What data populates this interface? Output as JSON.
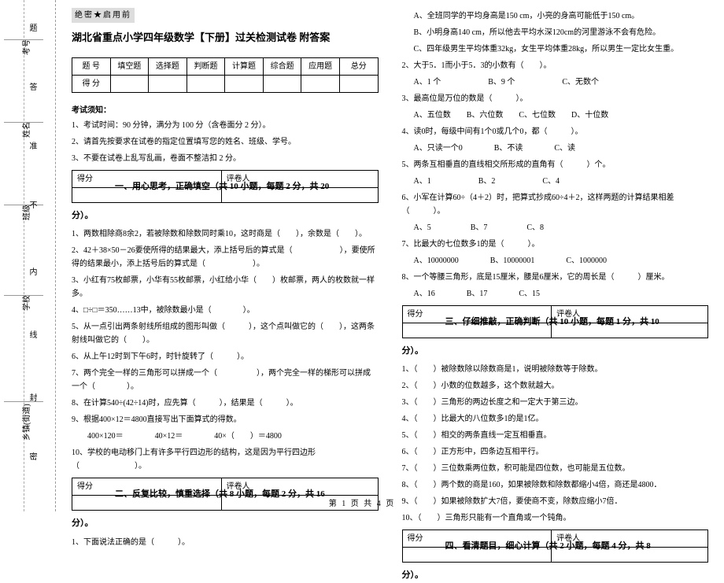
{
  "margin": {
    "fields": [
      "考号",
      "姓名",
      "班级",
      "学校",
      "乡镇(街道)"
    ],
    "seal_chars": [
      "题",
      "答",
      "准",
      "不",
      "内",
      "线",
      "封",
      "密"
    ]
  },
  "secret": "绝密★启用前",
  "title": "湖北省重点小学四年级数学【下册】过关检测试卷 附答案",
  "score_table": {
    "row1": [
      "题  号",
      "填空题",
      "选择题",
      "判断题",
      "计算题",
      "综合题",
      "应用题",
      "总分"
    ],
    "row2": [
      "得  分",
      "",
      "",
      "",
      "",
      "",
      "",
      ""
    ]
  },
  "notice": {
    "title": "考试须知：",
    "items": [
      "1、考试时间：90 分钟，满分为 100 分（含卷面分 2 分）。",
      "2、请首先按要求在试卷的指定位置填写您的姓名、班级、学号。",
      "3、不要在试卷上乱写乱画，卷面不整洁扣 2 分。"
    ]
  },
  "small_table": {
    "c1": "得分",
    "c2": "评卷人"
  },
  "s1": {
    "head": "一、用心思考，正确填空（共 10 小题，每题 2 分，共 20",
    "tail": "分）。",
    "q": [
      "1、两数相除商8余2，若被除数和除数同时乘10，这时商是（　　），余数是（　　）。",
      "2、42＋38×50－26要使所得的结果最大，添上括号后的算式是（　　　　　　），要使所得的结果最小，添上括号后的算式是（　　　　　　）。",
      "3、小红有75枚邮票，小华有55枚邮票，小红给小华（　　）枚邮票，两人的枚数就一样多。",
      "4、□÷□＝350……13中，被除数最小是（　　　　）。",
      "5、从一点引出两条射线所组成的图形叫做（　　　），这个点叫做它的（　　），这两条射线叫做它的（　　）。",
      "6、从上午12时到下午6时，时针旋转了（　　　）。",
      "7、两个完全一样的三角形可以拼成一个（　　　　　），两个完全一样的梯形可以拼成一个（　　　　）。",
      "8、在计算540÷(42÷14)时，应先算（　　　），结果是（　　　）。",
      "9、根据400×12＝4800直接写出下面算式的得数。",
      "　　400×120＝　　　　40×12＝　　　　40×（　　）＝4800",
      "10、学校的电动移门上有许多平行四边形的结构，这是因为平行四边形（　　　　　　　）。"
    ]
  },
  "s2": {
    "head": "二、反复比较，慎重选择（共 8 小题，每题 2 分，共 16",
    "tail": "分）。",
    "q1": "1、下面说法正确的是（　　　）。",
    "q1o": [
      "A、全班同学的平均身高是150 cm，小亮的身高可能低于150 cm。",
      "B、小明身高140 cm，所以他去平均水深120cm的河里游泳不会有危险。",
      "C、四年级男生平均体重32kg，女生平均体重28kg，所以男生一定比女生重。"
    ],
    "q2": "2、大于5．1而小于5．3的小数有（　　）。",
    "q2o": "A、1 个　　　　　　B、9 个　　　　　　C、无数个",
    "q3": "3、最高位是万位的数是（　　　）。",
    "q3o": "A、五位数　　B、六位数　　C、七位数　　D、十位数",
    "q4": "4、读0时，每级中间有1个0或几个0，都（　　　）。",
    "q4o": "A、只读一个0　　　　B、不读　　　　C、读",
    "q5": "5、两条互相垂直的直线相交所形成的直角有（　　　）个。",
    "q5o": "A、1　　　　　　B、2　　　　　　C、4",
    "q6": "6、小军在计算60÷（4＋2）时，把算式抄成60÷4＋2，这样两题的计算结果相差（　　　）。",
    "q6o": "A、5　　　　　B、7　　　　　C、8",
    "q7": "7、比最大的七位数多1的是（　　　）。",
    "q7o": "A、10000000　　　　B、10000001　　　　C、1000000",
    "q8": "8、一个等腰三角形，底是15厘米，腰是6厘米，它的周长是（　　　）厘米。",
    "q8o": "A、16　　　　B、17　　　　C、15"
  },
  "s3": {
    "head": "三、仔细推敲，正确判断（共 10 小题，每题 1 分，共 10",
    "tail": "分）。",
    "q": [
      "1、（　　）被除数除以除数商是1，说明被除数等于除数。",
      "2、（　　）小数的位数越多，这个数就越大。",
      "3、（　　）三角形的两边长度之和一定大于第三边。",
      "4、（　　）比最大的八位数多1的是1亿。",
      "5、（　　）相交的两条直线一定互相垂直。",
      "6、（　　）正方形中，四条边互相平行。",
      "7、（　　）三位数乘两位数，积可能是四位数，也可能是五位数。",
      "8、（　　）两个数的商是160，如果被除数和除数都缩小4倍，商还是4800．",
      "9、（　　）如果被除数扩大7倍，要使商不变，除数应缩小7倍．",
      "10、（　　）三角形只能有一个直角或一个钝角。"
    ]
  },
  "s4": {
    "head": "四、看清题目，细心计算（共 2 小题，每题 4 分，共 8",
    "tail": "分）。"
  },
  "footer": "第 1 页 共 4 页"
}
